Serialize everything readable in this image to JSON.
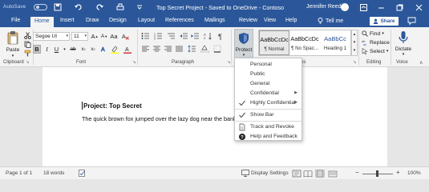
{
  "titlebar": {
    "autosave_label": "AutoSave",
    "autosave_state": "Off",
    "document_title": "Top Secret Project  -  Saved to OneDrive - Contoso",
    "user_name": "Jennifer Reed",
    "share_label": "Share"
  },
  "tabs": [
    "File",
    "Home",
    "Insert",
    "Draw",
    "Design",
    "Layout",
    "References",
    "Mailings",
    "Review",
    "View",
    "Help"
  ],
  "active_tab": "Home",
  "tell_me_label": "Tell me",
  "ribbon": {
    "paste_label": "Paste",
    "font_name": "Segoe UI",
    "font_size": "11",
    "protect_label": "Protect",
    "styles": [
      {
        "sample": "AaBbCcDc",
        "name": "¶ Normal"
      },
      {
        "sample": "AaBbCcDc",
        "name": "¶ No Spac..."
      },
      {
        "sample": "AaBbCc",
        "name": "Heading 1"
      }
    ],
    "find_label": "Find",
    "replace_label": "Replace",
    "select_label": "Select",
    "dictate_label": "Dictate",
    "groups": {
      "clipboard": "Clipboard",
      "font": "Font",
      "paragraph": "Paragraph",
      "styles": "Styles",
      "editing": "Editing",
      "voice": "Voice"
    }
  },
  "document": {
    "heading": "Project: Top Secret",
    "paragraph": "The quick brown fox jumped over the lazy dog near the bank o"
  },
  "protect_menu": {
    "items": [
      {
        "label": "Personal",
        "checked": false,
        "submenu": false
      },
      {
        "label": "Public",
        "checked": false,
        "submenu": false
      },
      {
        "label": "General",
        "checked": false,
        "submenu": false
      },
      {
        "label": "Confidential",
        "checked": false,
        "submenu": true
      },
      {
        "label": "Highly Confidential",
        "checked": true,
        "submenu": true
      }
    ],
    "show_bar_label": "Show Bar",
    "track_revoke_label": "Track and Revoke",
    "help_feedback_label": "Help and Feedback"
  },
  "statusbar": {
    "page_info": "Page 1 of 1",
    "word_count": "18 words",
    "display_settings": "Display Settings",
    "zoom_level": "100%",
    "zoom_minus": "−",
    "zoom_plus": "+"
  },
  "colors": {
    "brand": "#2b579a",
    "heading_style": "#2f5597",
    "font_color_red": "#d13438",
    "highlight_yellow": "#ffff00"
  }
}
